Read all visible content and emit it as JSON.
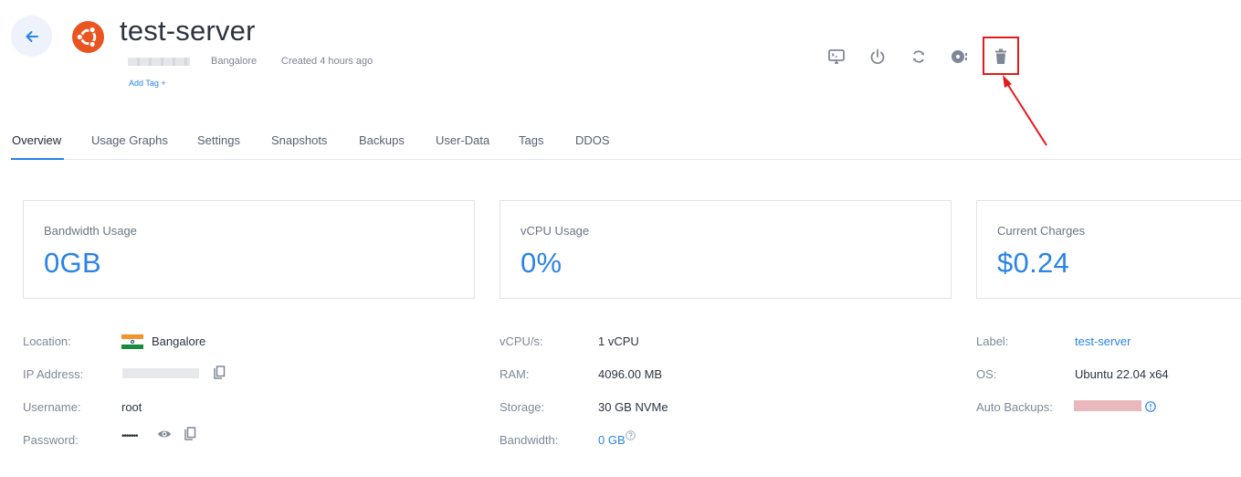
{
  "header": {
    "title": "test-server",
    "location": "Bangalore",
    "created": "Created 4 hours ago",
    "add_tag": "Add Tag +"
  },
  "actions": [
    {
      "name": "console-icon"
    },
    {
      "name": "power-icon"
    },
    {
      "name": "restart-icon"
    },
    {
      "name": "disk-icon"
    },
    {
      "name": "trash-icon"
    }
  ],
  "tabs": [
    "Overview",
    "Usage Graphs",
    "Settings",
    "Snapshots",
    "Backups",
    "User-Data",
    "Tags",
    "DDOS"
  ],
  "active_tab": "Overview",
  "cards": [
    {
      "label": "Bandwidth Usage",
      "value": "0GB"
    },
    {
      "label": "vCPU Usage",
      "value": "0%"
    },
    {
      "label": "Current Charges",
      "value": "$0.24"
    }
  ],
  "details": {
    "col1": {
      "location_label": "Location:",
      "location_value": "Bangalore",
      "ip_label": "IP Address:",
      "username_label": "Username:",
      "username_value": "root",
      "password_label": "Password:",
      "password_value": "•••••••"
    },
    "col2": {
      "vcpu_label": "vCPU/s:",
      "vcpu_value": "1 vCPU",
      "ram_label": "RAM:",
      "ram_value": "4096.00 MB",
      "storage_label": "Storage:",
      "storage_value": "30 GB NVMe",
      "bandwidth_label": "Bandwidth:",
      "bandwidth_value": "0 GB"
    },
    "col3": {
      "label_label": "Label:",
      "label_value": "test-server",
      "os_label": "OS:",
      "os_value": "Ubuntu 22.04 x64",
      "backups_label": "Auto Backups:"
    }
  },
  "colors": {
    "accent": "#2a83e8",
    "ubuntu": "#e95420",
    "highlight": "#e41b1b"
  }
}
